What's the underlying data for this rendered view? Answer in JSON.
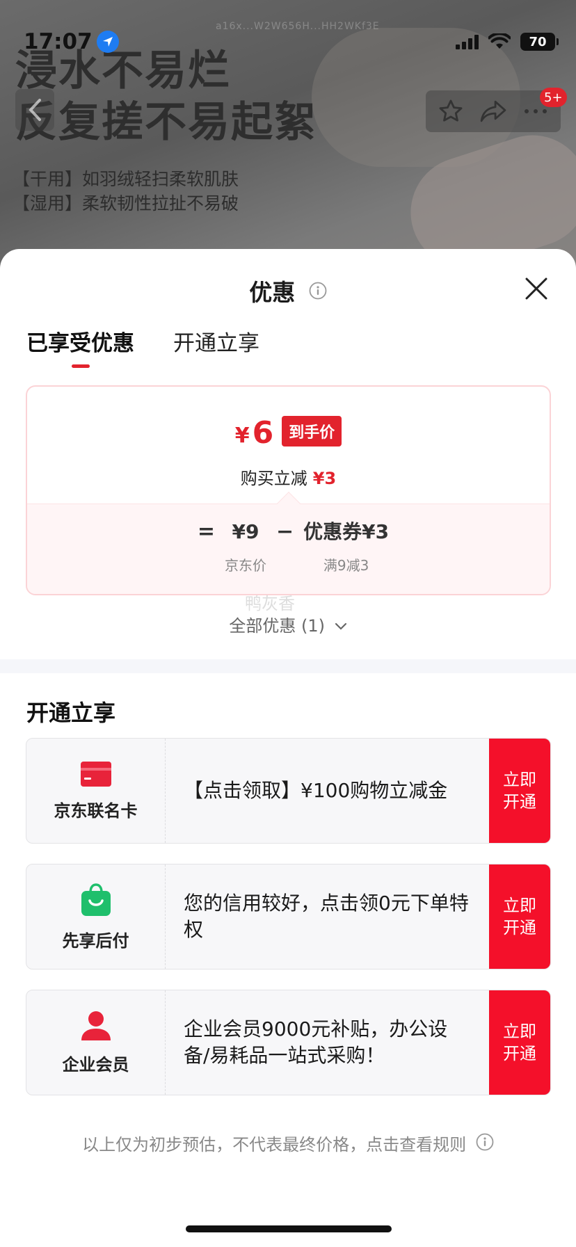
{
  "status_bar": {
    "time": "17:07",
    "battery": "70"
  },
  "background": {
    "headline_1": "浸水不易烂",
    "headline_2": "反复搓不易起絮",
    "subline_1": "【干用】如羽绒轻扫柔软肌肤",
    "subline_2": "【湿用】柔软韧性拉扯不易破",
    "watermark": "a16x...W2W656H...HH2WKf3E"
  },
  "nav": {
    "badge": "5+"
  },
  "sheet": {
    "title": "优惠",
    "tabs": [
      {
        "label": "已享受优惠",
        "active": true
      },
      {
        "label": "开通立享",
        "active": false
      }
    ],
    "price_card": {
      "final_yen": "¥",
      "final_price": "6",
      "final_tag": "到手价",
      "reduce_label": "购买立减",
      "reduce_value": "¥3",
      "eq": "=",
      "minus": "−",
      "jd_price_value": "¥9",
      "jd_price_label": "京东价",
      "coupon_value": "优惠券¥3",
      "coupon_label": "满9减3"
    },
    "all_discount": "全部优惠 (1)",
    "watermark": "鸭灰香",
    "section_title": "开通立享",
    "offers": [
      {
        "name": "京东联名卡",
        "icon": "card-icon",
        "desc": "【点击领取】¥100购物立减金",
        "button": "立即开通"
      },
      {
        "name": "先享后付",
        "icon": "shopping-bag-icon",
        "desc": "您的信用较好，点击领0元下单特权",
        "button": "立即开通"
      },
      {
        "name": "企业会员",
        "icon": "user-icon",
        "desc": "企业会员9000元补贴，办公设备/易耗品一站式采购！",
        "button": "立即开通"
      }
    ],
    "footnote": "以上仅为初步预估，不代表最终价格，点击查看规则"
  },
  "colors": {
    "accent": "#e2232d",
    "button_red": "#f4102a",
    "card_icon": "#e8233a",
    "bag_icon": "#1fbf6c"
  }
}
